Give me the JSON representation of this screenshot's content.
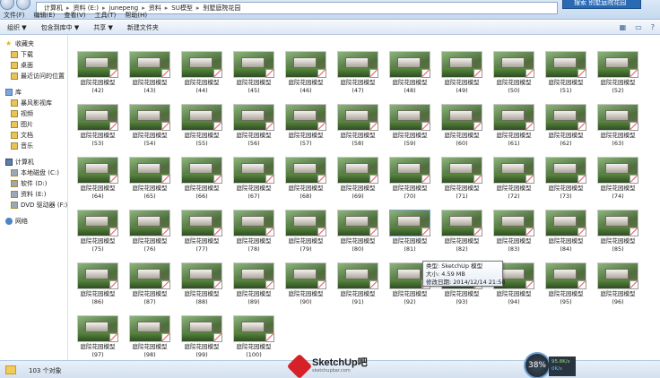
{
  "address_bar": {
    "crumbs": [
      "计算机",
      "资料 (E:)",
      "junepeng",
      "资料",
      "SU模型",
      "别墅庭院花园"
    ],
    "search_label": "搜索 别墅庭院花园"
  },
  "menu": [
    "文件(F)",
    "编辑(E)",
    "查看(V)",
    "工具(T)",
    "帮助(H)"
  ],
  "toolbar": {
    "organize": "组织 ▼",
    "include_in_library": "包含到库中 ▼",
    "share": "共享 ▼",
    "new_folder": "新建文件夹"
  },
  "sidebar": {
    "favorites": {
      "label": "收藏夹",
      "items": [
        "下载",
        "桌面",
        "最近访问的位置"
      ]
    },
    "libraries": {
      "label": "库",
      "items": [
        "暴风影视库",
        "视频",
        "图片",
        "文档",
        "音乐"
      ]
    },
    "computer": {
      "label": "计算机",
      "items": [
        "本地磁盘 (C:)",
        "软件 (D:)",
        "资料 (E:)",
        "DVD 驱动器 (F:) Au"
      ]
    },
    "network": {
      "label": "网络"
    }
  },
  "files": {
    "name": "庭院花园模型",
    "numbers": [
      "(42)",
      "(43)",
      "(44)",
      "(45)",
      "(46)",
      "(47)",
      "(48)",
      "(49)",
      "(50)",
      "(51)",
      "(52)",
      "(53)",
      "(54)",
      "(55)",
      "(56)",
      "(57)",
      "(58)",
      "(59)",
      "(60)",
      "(61)",
      "(62)",
      "(63)",
      "(64)",
      "(65)",
      "(66)",
      "(67)",
      "(68)",
      "(69)",
      "(70)",
      "(71)",
      "(72)",
      "(73)",
      "(74)",
      "(75)",
      "(76)",
      "(77)",
      "(78)",
      "(79)",
      "(80)",
      "(81)",
      "(82)",
      "(83)",
      "(84)",
      "(85)",
      "(86)",
      "(87)",
      "(88)",
      "(89)",
      "(90)",
      "(91)",
      "(92)",
      "(93)",
      "(94)",
      "(95)",
      "(96)",
      "(97)",
      "(98)",
      "(99)",
      "(100)"
    ],
    "selected": "(81)"
  },
  "tooltip": {
    "type": "类型: SketchUp 模型",
    "size": "大小: 4.59 MB",
    "modified": "修改日期: 2014/12/14 21:58"
  },
  "status": {
    "count": "103 个对象"
  },
  "watermark": {
    "brand": "SketchUp吧",
    "site": "sketchupbar.com"
  },
  "net_gauge": {
    "percent": "38%",
    "up": "95.8K/s",
    "down": "0K/s"
  },
  "colors": {
    "accent": "#2a6ab5",
    "badge": "#d33333",
    "gauge_ring": "#6fa4d8"
  }
}
